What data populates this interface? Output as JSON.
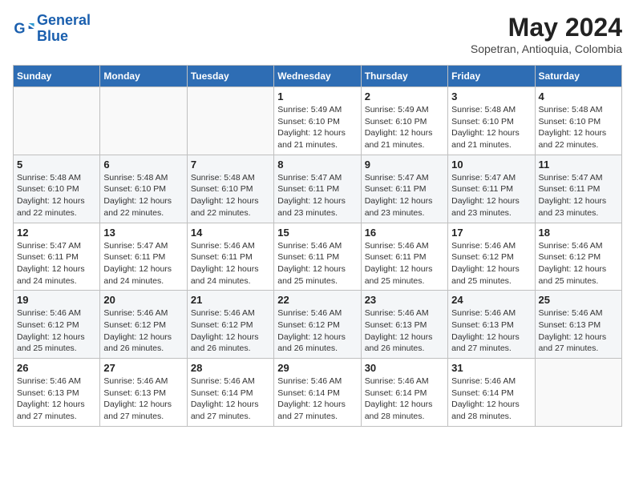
{
  "header": {
    "logo_line1": "General",
    "logo_line2": "Blue",
    "month_year": "May 2024",
    "location": "Sopetran, Antioquia, Colombia"
  },
  "weekdays": [
    "Sunday",
    "Monday",
    "Tuesday",
    "Wednesday",
    "Thursday",
    "Friday",
    "Saturday"
  ],
  "weeks": [
    [
      {
        "day": "",
        "info": ""
      },
      {
        "day": "",
        "info": ""
      },
      {
        "day": "",
        "info": ""
      },
      {
        "day": "1",
        "info": "Sunrise: 5:49 AM\nSunset: 6:10 PM\nDaylight: 12 hours\nand 21 minutes."
      },
      {
        "day": "2",
        "info": "Sunrise: 5:49 AM\nSunset: 6:10 PM\nDaylight: 12 hours\nand 21 minutes."
      },
      {
        "day": "3",
        "info": "Sunrise: 5:48 AM\nSunset: 6:10 PM\nDaylight: 12 hours\nand 21 minutes."
      },
      {
        "day": "4",
        "info": "Sunrise: 5:48 AM\nSunset: 6:10 PM\nDaylight: 12 hours\nand 22 minutes."
      }
    ],
    [
      {
        "day": "5",
        "info": "Sunrise: 5:48 AM\nSunset: 6:10 PM\nDaylight: 12 hours\nand 22 minutes."
      },
      {
        "day": "6",
        "info": "Sunrise: 5:48 AM\nSunset: 6:10 PM\nDaylight: 12 hours\nand 22 minutes."
      },
      {
        "day": "7",
        "info": "Sunrise: 5:48 AM\nSunset: 6:10 PM\nDaylight: 12 hours\nand 22 minutes."
      },
      {
        "day": "8",
        "info": "Sunrise: 5:47 AM\nSunset: 6:11 PM\nDaylight: 12 hours\nand 23 minutes."
      },
      {
        "day": "9",
        "info": "Sunrise: 5:47 AM\nSunset: 6:11 PM\nDaylight: 12 hours\nand 23 minutes."
      },
      {
        "day": "10",
        "info": "Sunrise: 5:47 AM\nSunset: 6:11 PM\nDaylight: 12 hours\nand 23 minutes."
      },
      {
        "day": "11",
        "info": "Sunrise: 5:47 AM\nSunset: 6:11 PM\nDaylight: 12 hours\nand 23 minutes."
      }
    ],
    [
      {
        "day": "12",
        "info": "Sunrise: 5:47 AM\nSunset: 6:11 PM\nDaylight: 12 hours\nand 24 minutes."
      },
      {
        "day": "13",
        "info": "Sunrise: 5:47 AM\nSunset: 6:11 PM\nDaylight: 12 hours\nand 24 minutes."
      },
      {
        "day": "14",
        "info": "Sunrise: 5:46 AM\nSunset: 6:11 PM\nDaylight: 12 hours\nand 24 minutes."
      },
      {
        "day": "15",
        "info": "Sunrise: 5:46 AM\nSunset: 6:11 PM\nDaylight: 12 hours\nand 25 minutes."
      },
      {
        "day": "16",
        "info": "Sunrise: 5:46 AM\nSunset: 6:11 PM\nDaylight: 12 hours\nand 25 minutes."
      },
      {
        "day": "17",
        "info": "Sunrise: 5:46 AM\nSunset: 6:12 PM\nDaylight: 12 hours\nand 25 minutes."
      },
      {
        "day": "18",
        "info": "Sunrise: 5:46 AM\nSunset: 6:12 PM\nDaylight: 12 hours\nand 25 minutes."
      }
    ],
    [
      {
        "day": "19",
        "info": "Sunrise: 5:46 AM\nSunset: 6:12 PM\nDaylight: 12 hours\nand 25 minutes."
      },
      {
        "day": "20",
        "info": "Sunrise: 5:46 AM\nSunset: 6:12 PM\nDaylight: 12 hours\nand 26 minutes."
      },
      {
        "day": "21",
        "info": "Sunrise: 5:46 AM\nSunset: 6:12 PM\nDaylight: 12 hours\nand 26 minutes."
      },
      {
        "day": "22",
        "info": "Sunrise: 5:46 AM\nSunset: 6:12 PM\nDaylight: 12 hours\nand 26 minutes."
      },
      {
        "day": "23",
        "info": "Sunrise: 5:46 AM\nSunset: 6:13 PM\nDaylight: 12 hours\nand 26 minutes."
      },
      {
        "day": "24",
        "info": "Sunrise: 5:46 AM\nSunset: 6:13 PM\nDaylight: 12 hours\nand 27 minutes."
      },
      {
        "day": "25",
        "info": "Sunrise: 5:46 AM\nSunset: 6:13 PM\nDaylight: 12 hours\nand 27 minutes."
      }
    ],
    [
      {
        "day": "26",
        "info": "Sunrise: 5:46 AM\nSunset: 6:13 PM\nDaylight: 12 hours\nand 27 minutes."
      },
      {
        "day": "27",
        "info": "Sunrise: 5:46 AM\nSunset: 6:13 PM\nDaylight: 12 hours\nand 27 minutes."
      },
      {
        "day": "28",
        "info": "Sunrise: 5:46 AM\nSunset: 6:14 PM\nDaylight: 12 hours\nand 27 minutes."
      },
      {
        "day": "29",
        "info": "Sunrise: 5:46 AM\nSunset: 6:14 PM\nDaylight: 12 hours\nand 27 minutes."
      },
      {
        "day": "30",
        "info": "Sunrise: 5:46 AM\nSunset: 6:14 PM\nDaylight: 12 hours\nand 28 minutes."
      },
      {
        "day": "31",
        "info": "Sunrise: 5:46 AM\nSunset: 6:14 PM\nDaylight: 12 hours\nand 28 minutes."
      },
      {
        "day": "",
        "info": ""
      }
    ]
  ]
}
